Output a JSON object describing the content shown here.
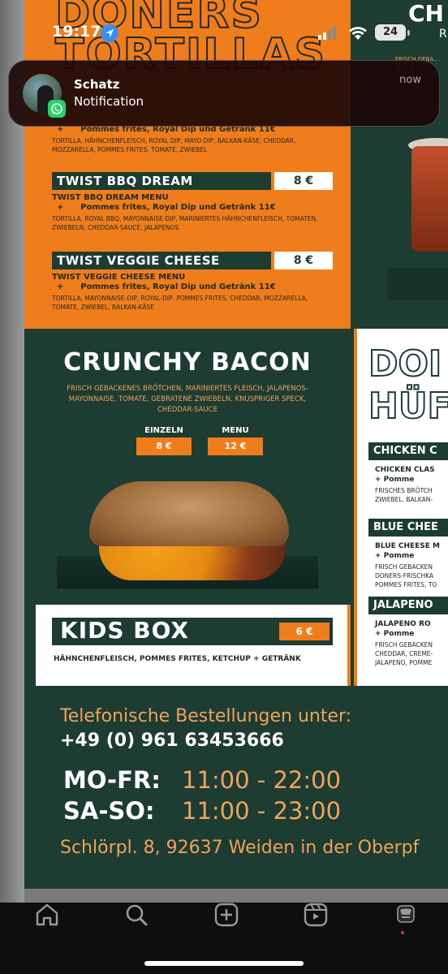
{
  "status_bar": {
    "time": "19:17",
    "battery": "24"
  },
  "notification": {
    "title": "Schatz",
    "body": "Notification",
    "time": "now",
    "app_icon": "whatsapp-icon"
  },
  "menu": {
    "top_left": {
      "title_line1": "DONERS",
      "title_line2": "TORTILLAS",
      "items": [
        {
          "menu_line": "Pommes frites, Royal Dip und Getränk 11€",
          "desc": "TORTILLA, HÄHNCHENFLEISCH, ROYAL DIP, MAYO DIP, BALKAN-KÄSE, CHEDDAR, MOZZARELLA, POMMES FRITES, TOMATE, ZWIEBEL"
        },
        {
          "name": "TWIST BBQ DREAM",
          "price": "8 €",
          "menu_title": "TWIST BBQ DREAM MENU",
          "menu_line": "Pommes frites, Royal Dip und Getränk 11€",
          "desc": "TORTILLA, ROYAL BBQ, MAYONNAISE-DIP, MARINIERTES HÄHNCHENFLEISCH, TOMATEN, ZWIEBELN, CHEDDAR-SAUCE, JALAPENOS"
        },
        {
          "name": "TWIST VEGGIE CHEESE",
          "price": "8 €",
          "menu_title": "TWIST VEGGIE CHEESE MENU",
          "menu_line": "Pommes frites, Royal Dip und Getränk 11€",
          "desc": "TORTILLA, MAYONNAISE-DIP, ROYAL-DIP, POMMES FRITES, CHEDDAR, MOZZARELLA, TOMATE, ZWIEBEL, BALKAN-KÄSE"
        }
      ]
    },
    "top_right": {
      "title": "CH",
      "sub": "R",
      "tiny": "FRISCH GEBA… KES, R…"
    },
    "bacon": {
      "title": "CRUNCHY BACON",
      "desc": "FRISCH GEBACKENES BRÖTCHEN, MARINIERTES FLEISCH, JALAPENOS-MAYONNAISE, TOMATE, GEBRATENE ZWIEBELN, KNUSPRIGER SPECK, CHEDDAR-SAUCE",
      "single_label": "EINZELN",
      "single_price": "8 €",
      "menu_label": "MENU",
      "menu_price": "12 €"
    },
    "kids": {
      "title": "KIDS BOX",
      "price": "6 €",
      "desc": "HÄHNCHENFLEISCH, POMMES FRITES, KETCHUP + GETRÄNK"
    },
    "right_panel": {
      "title_line1": "DOI",
      "title_line2": "HÜF",
      "sections": [
        {
          "bar": "CHICKEN C",
          "line1": "CHICKEN CLAS",
          "line2": "+      Pomme",
          "small1": "FRISCHES BRÖTCH",
          "small2": "ZWIEBEL, BALKAN-"
        },
        {
          "bar": "BLUE CHEE",
          "line1": "BLUE CHEESE M",
          "line2": "+      Pomme",
          "small1": "FRISCH GEBACKEN",
          "small2": "DONERS-FRISCHKA",
          "small3": "POMMES FRITES, TO"
        },
        {
          "bar": "JALAPENO",
          "line1": "JALAPENO RO",
          "line2": "+      Pomme",
          "small1": "FRISCH GEBACKEN",
          "small2": "CHEDDAR, CREME-",
          "small3": "JALAPENO, POMME"
        }
      ]
    },
    "info": {
      "phone_label": "Telefonische Bestellungen unter:",
      "phone": "+49 (0) 961 63453666",
      "weekday_label": "MO-FR:",
      "weekday_hours": "11:00 - 22:00",
      "weekend_label": "SA-SO:",
      "weekend_hours": "11:00 - 23:00",
      "address": "Schlörpl. 8, 92637 Weiden in der Oberpf"
    }
  },
  "nav": {
    "items": [
      "home-icon",
      "search-icon",
      "create-icon",
      "reels-icon",
      "profile-icon"
    ]
  },
  "colors": {
    "orange": "#f07d1c",
    "green": "#1d3c32"
  }
}
